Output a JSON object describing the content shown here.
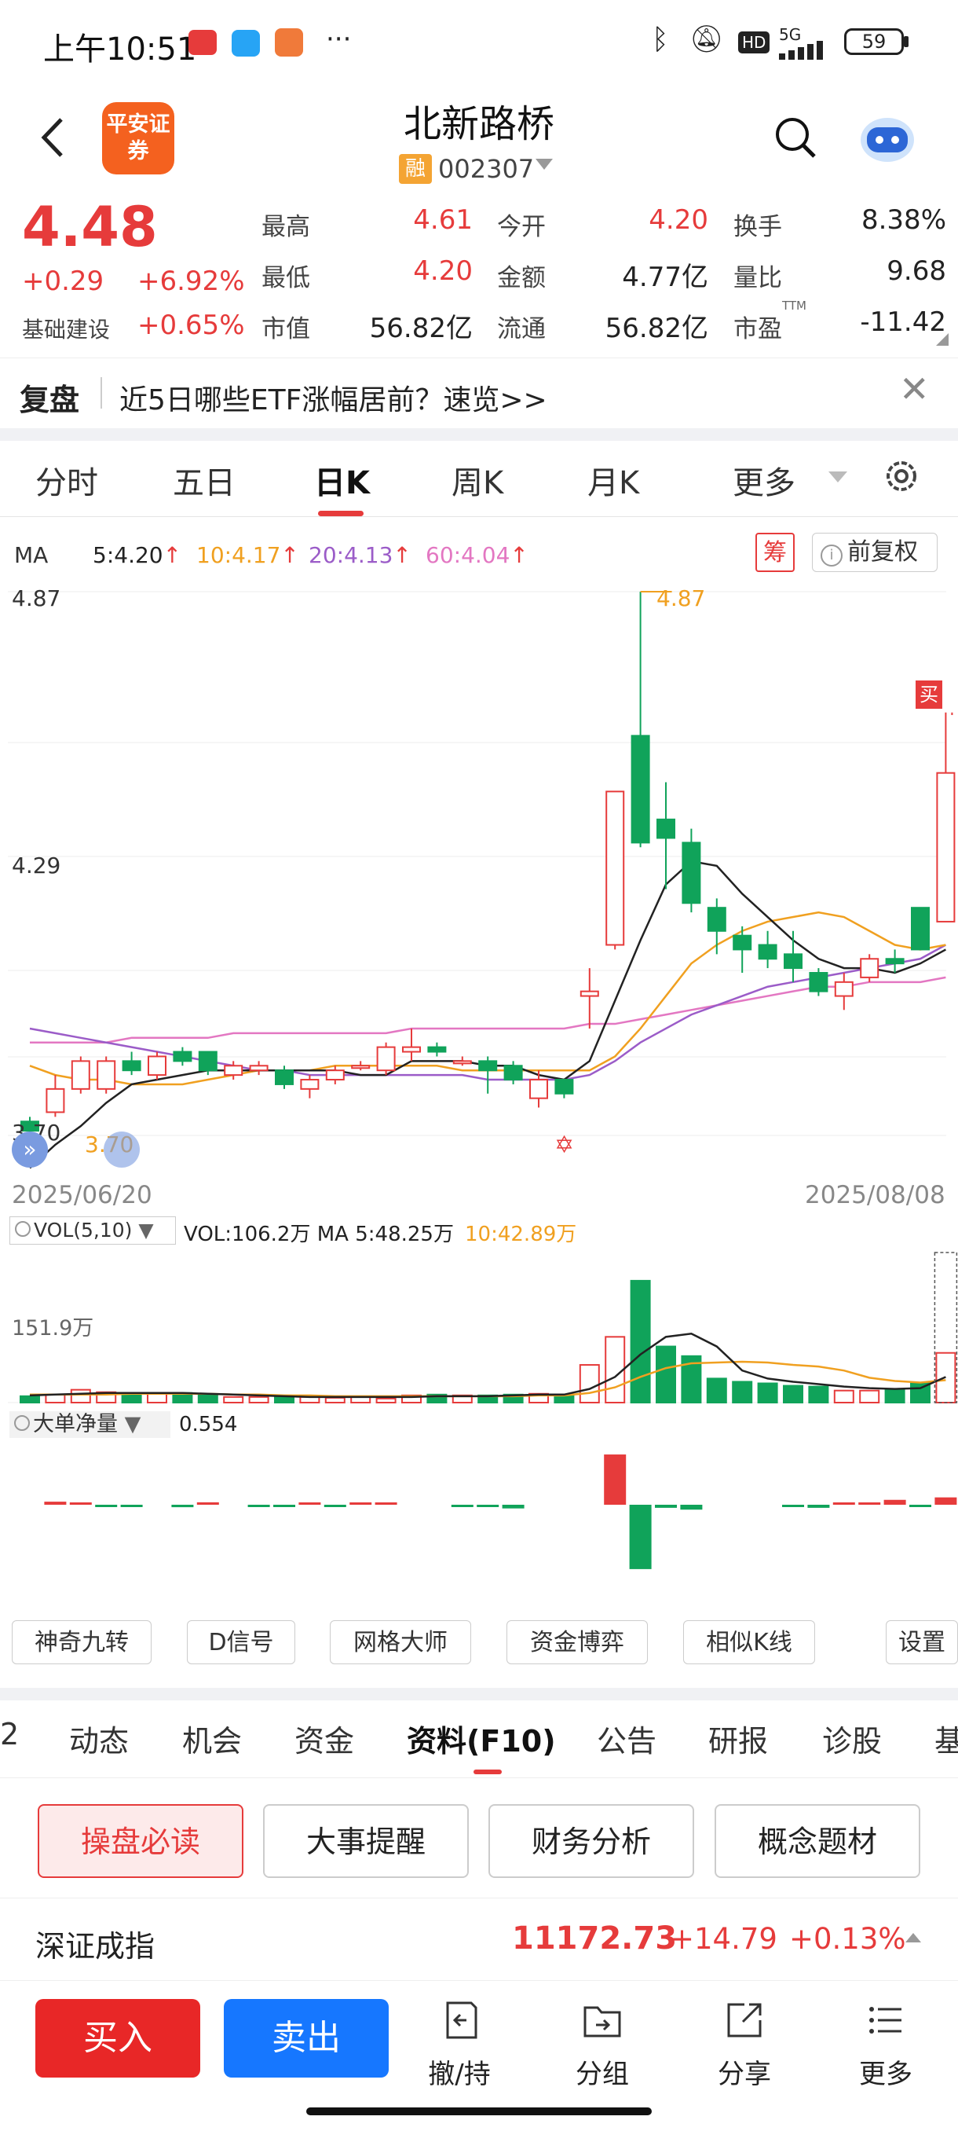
{
  "status_bar": {
    "time": "上午10:51",
    "battery": "59",
    "signal": "5G",
    "hd": "HD"
  },
  "header": {
    "logo_text": "平安证券",
    "stock_name": "北新路桥",
    "rong_badge": "融",
    "stock_code": "002307"
  },
  "quote": {
    "price": "4.48",
    "change": "+0.29",
    "change_pct": "+6.92%",
    "sector_name": "基础建设",
    "sector_pct": "+0.65%",
    "rows": [
      [
        {
          "label": "最高",
          "value": "4.61",
          "color": "red"
        },
        {
          "label": "今开",
          "value": "4.20",
          "color": "red"
        },
        {
          "label": "换手",
          "value": "8.38%",
          "color": "dark"
        }
      ],
      [
        {
          "label": "最低",
          "value": "4.20",
          "color": "red"
        },
        {
          "label": "金额",
          "value": "4.77亿",
          "color": "dark"
        },
        {
          "label": "量比",
          "value": "9.68",
          "color": "dark"
        }
      ],
      [
        {
          "label": "市值",
          "value": "56.82亿",
          "color": "dark"
        },
        {
          "label": "流通",
          "value": "56.82亿",
          "color": "dark"
        },
        {
          "label": "市盈",
          "value": "-11.42",
          "color": "dark"
        }
      ]
    ],
    "ttm": "TTM"
  },
  "banner": {
    "tag": "复盘",
    "text": "近5日哪些ETF涨幅居前？速览>>"
  },
  "period_tabs": [
    {
      "label": "分时",
      "active": false
    },
    {
      "label": "五日",
      "active": false
    },
    {
      "label": "日K",
      "active": true
    },
    {
      "label": "周K",
      "active": false
    },
    {
      "label": "月K",
      "active": false
    },
    {
      "label": "更多",
      "active": false
    }
  ],
  "ma_legend": {
    "ma": "MA",
    "ma5": "5:4.20",
    "ma10": "10:4.17",
    "ma20": "20:4.13",
    "ma60": "60:4.04",
    "chou": "筹",
    "fuquan": "前复权"
  },
  "chart_labels": {
    "y_top": "4.87",
    "y_mid": "4.29",
    "y_low": "3.70",
    "high_mark": "4.87",
    "low_mark": "3.70",
    "date_start": "2025/06/20",
    "date_end": "2025/08/08",
    "buy_tag": "买"
  },
  "colors": {
    "up": "#e63b3b",
    "down": "#10a35a",
    "ma5": "#222222",
    "ma10": "#f0a020",
    "ma20": "#9b5cc8",
    "ma60": "#e377c2",
    "brand": "#f4611f",
    "sell": "#1677ff"
  },
  "chart_data": {
    "type": "candlestick",
    "ylim": [
      3.7,
      4.87
    ],
    "candles": [
      {
        "o": 3.73,
        "c": 3.71,
        "h": 3.74,
        "l": 3.7
      },
      {
        "o": 3.75,
        "c": 3.8,
        "h": 3.83,
        "l": 3.74
      },
      {
        "o": 3.8,
        "c": 3.86,
        "h": 3.87,
        "l": 3.79
      },
      {
        "o": 3.8,
        "c": 3.86,
        "h": 3.87,
        "l": 3.79
      },
      {
        "o": 3.86,
        "c": 3.84,
        "h": 3.88,
        "l": 3.83
      },
      {
        "o": 3.83,
        "c": 3.87,
        "h": 3.88,
        "l": 3.82
      },
      {
        "o": 3.88,
        "c": 3.86,
        "h": 3.89,
        "l": 3.85
      },
      {
        "o": 3.88,
        "c": 3.84,
        "h": 3.88,
        "l": 3.83
      },
      {
        "o": 3.83,
        "c": 3.85,
        "h": 3.86,
        "l": 3.82
      },
      {
        "o": 3.84,
        "c": 3.85,
        "h": 3.86,
        "l": 3.83
      },
      {
        "o": 3.84,
        "c": 3.81,
        "h": 3.85,
        "l": 3.8
      },
      {
        "o": 3.8,
        "c": 3.82,
        "h": 3.83,
        "l": 3.78
      },
      {
        "o": 3.82,
        "c": 3.84,
        "h": 3.85,
        "l": 3.81
      },
      {
        "o": 3.85,
        "c": 3.85,
        "h": 3.86,
        "l": 3.84
      },
      {
        "o": 3.84,
        "c": 3.89,
        "h": 3.9,
        "l": 3.83
      },
      {
        "o": 3.88,
        "c": 3.89,
        "h": 3.93,
        "l": 3.86
      },
      {
        "o": 3.89,
        "c": 3.88,
        "h": 3.9,
        "l": 3.87
      },
      {
        "o": 3.86,
        "c": 3.86,
        "h": 3.87,
        "l": 3.85
      },
      {
        "o": 3.86,
        "c": 3.84,
        "h": 3.87,
        "l": 3.79
      },
      {
        "o": 3.85,
        "c": 3.82,
        "h": 3.86,
        "l": 3.81
      },
      {
        "o": 3.78,
        "c": 3.82,
        "h": 3.84,
        "l": 3.76
      },
      {
        "o": 3.82,
        "c": 3.79,
        "h": 3.82,
        "l": 3.78
      },
      {
        "o": 4.0,
        "c": 4.01,
        "h": 4.06,
        "l": 3.93
      },
      {
        "o": 4.11,
        "c": 4.44,
        "h": 4.44,
        "l": 4.1
      },
      {
        "o": 4.56,
        "c": 4.33,
        "h": 4.87,
        "l": 4.32
      },
      {
        "o": 4.38,
        "c": 4.34,
        "h": 4.46,
        "l": 4.23
      },
      {
        "o": 4.33,
        "c": 4.2,
        "h": 4.36,
        "l": 4.18
      },
      {
        "o": 4.19,
        "c": 4.14,
        "h": 4.21,
        "l": 4.09
      },
      {
        "o": 4.13,
        "c": 4.1,
        "h": 4.15,
        "l": 4.05
      },
      {
        "o": 4.11,
        "c": 4.08,
        "h": 4.14,
        "l": 4.06
      },
      {
        "o": 4.09,
        "c": 4.06,
        "h": 4.14,
        "l": 4.03
      },
      {
        "o": 4.05,
        "c": 4.01,
        "h": 4.06,
        "l": 4.0
      },
      {
        "o": 4.0,
        "c": 4.03,
        "h": 4.05,
        "l": 3.97
      },
      {
        "o": 4.04,
        "c": 4.08,
        "h": 4.09,
        "l": 4.03
      },
      {
        "o": 4.08,
        "c": 4.07,
        "h": 4.1,
        "l": 4.05
      },
      {
        "o": 4.19,
        "c": 4.1,
        "h": 4.19,
        "l": 4.1
      },
      {
        "o": 4.16,
        "c": 4.48,
        "h": 4.61,
        "l": 4.16
      }
    ],
    "ma5": [
      3.63,
      3.68,
      3.72,
      3.77,
      3.81,
      3.82,
      3.83,
      3.84,
      3.84,
      3.84,
      3.84,
      3.84,
      3.84,
      3.83,
      3.83,
      3.86,
      3.86,
      3.86,
      3.85,
      3.85,
      3.83,
      3.82,
      3.86,
      3.99,
      4.12,
      4.24,
      4.29,
      4.28,
      4.22,
      4.17,
      4.12,
      4.08,
      4.06,
      4.06,
      4.05,
      4.07,
      4.1
    ],
    "ma10": [
      3.85,
      3.83,
      3.82,
      3.82,
      3.81,
      3.81,
      3.81,
      3.82,
      3.83,
      3.84,
      3.84,
      3.84,
      3.85,
      3.85,
      3.85,
      3.85,
      3.85,
      3.84,
      3.84,
      3.84,
      3.84,
      3.84,
      3.84,
      3.87,
      3.93,
      4.0,
      4.07,
      4.11,
      4.14,
      4.16,
      4.17,
      4.18,
      4.17,
      4.14,
      4.11,
      4.1,
      4.11
    ],
    "ma20": [
      3.93,
      3.92,
      3.91,
      3.9,
      3.89,
      3.88,
      3.87,
      3.86,
      3.85,
      3.84,
      3.84,
      3.83,
      3.83,
      3.83,
      3.83,
      3.83,
      3.83,
      3.83,
      3.82,
      3.82,
      3.82,
      3.82,
      3.83,
      3.86,
      3.9,
      3.93,
      3.96,
      3.98,
      4.0,
      4.02,
      4.03,
      4.04,
      4.05,
      4.06,
      4.07,
      4.08,
      4.11
    ],
    "ma60": [
      3.9,
      3.9,
      3.9,
      3.9,
      3.91,
      3.91,
      3.91,
      3.91,
      3.92,
      3.92,
      3.92,
      3.92,
      3.92,
      3.92,
      3.92,
      3.93,
      3.93,
      3.93,
      3.93,
      3.93,
      3.93,
      3.93,
      3.94,
      3.94,
      3.95,
      3.96,
      3.97,
      3.98,
      3.99,
      4.0,
      4.01,
      4.02,
      4.02,
      4.03,
      4.03,
      4.03,
      4.04
    ],
    "volume": {
      "legend": "VOL(5,10)",
      "stats": "VOL:106.2万 MA 5:48.25万",
      "stats_ma10": "10:42.89万",
      "axis_label": "151.9万",
      "max": 151.9,
      "values": [
        8,
        10,
        16,
        13,
        10,
        12,
        12,
        9,
        7,
        7,
        8,
        7,
        6,
        7,
        5,
        9,
        10,
        9,
        9,
        10,
        11,
        10,
        47,
        82,
        152,
        70,
        58,
        30,
        26,
        24,
        21,
        20,
        15,
        15,
        16,
        25,
        62
      ],
      "ma5": [
        9,
        10,
        11,
        12,
        12,
        12,
        12,
        11,
        10,
        9,
        8,
        7,
        7,
        7,
        7,
        7,
        8,
        8,
        8,
        9,
        10,
        10,
        17,
        32,
        60,
        82,
        86,
        70,
        40,
        30,
        26,
        23,
        20,
        18,
        17,
        18,
        32
      ],
      "ma10": [
        10,
        10,
        10,
        10,
        11,
        11,
        11,
        11,
        10,
        10,
        9,
        9,
        8,
        8,
        8,
        8,
        8,
        8,
        8,
        8,
        9,
        9,
        12,
        19,
        32,
        43,
        49,
        50,
        51,
        50,
        47,
        45,
        40,
        31,
        27,
        25,
        28
      ]
    },
    "netflow": {
      "legend": "大单净量",
      "value": "0.554",
      "values": [
        0,
        0.05,
        0.03,
        -0.01,
        -0.01,
        0,
        -0.04,
        0.04,
        0,
        -0.02,
        -0.03,
        0.03,
        -0.03,
        0.02,
        0.01,
        0,
        0,
        -0.02,
        -0.02,
        -0.06,
        0,
        0,
        0,
        0.82,
        -1.05,
        -0.05,
        -0.08,
        0,
        0,
        0,
        -0.02,
        -0.05,
        0.02,
        0.03,
        0.08,
        -0.02,
        0.12
      ]
    }
  },
  "indicator_buttons": [
    "神奇九转",
    "D信号",
    "网格大师",
    "资金博弈",
    "相似K线",
    "设置"
  ],
  "f10_tabs": [
    "2",
    "动态",
    "机会",
    "资金",
    "资料(F10)",
    "公告",
    "研报",
    "诊股",
    "基"
  ],
  "info_buttons": [
    "操盘必读",
    "大事提醒",
    "财务分析",
    "概念题材"
  ],
  "index_bar": {
    "name": "深证成指",
    "value": "11172.73",
    "change": "+14.79",
    "pct": "+0.13%"
  },
  "bottom_bar": {
    "buy": "买入",
    "sell": "卖出",
    "items": [
      {
        "label": "撤/持",
        "icon": "undo-doc-icon"
      },
      {
        "label": "分组",
        "icon": "folder-icon"
      },
      {
        "label": "分享",
        "icon": "share-icon"
      },
      {
        "label": "更多",
        "icon": "list-icon"
      }
    ]
  }
}
